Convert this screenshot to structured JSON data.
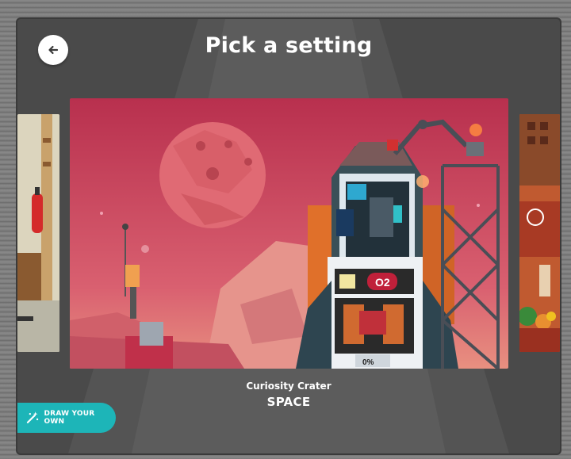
{
  "header": {
    "title": "Pick a setting",
    "back_icon": "arrow-left-icon"
  },
  "carousel": {
    "selected": {
      "subtitle": "Curiosity Crater",
      "name": "SPACE",
      "oxygen_label": "O2",
      "gauge_label": "0%"
    }
  },
  "draw_button": {
    "label": "DRAW YOUR OWN",
    "icon": "magic-wand-icon"
  },
  "colors": {
    "panel": "#4a4a4a",
    "accent": "#1db5b8",
    "sky": "#c8405a"
  }
}
